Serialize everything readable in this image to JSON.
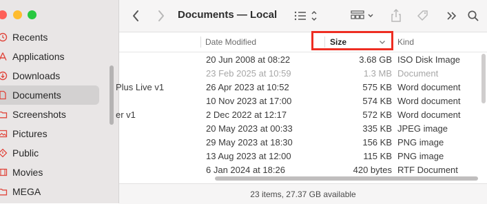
{
  "window": {
    "title": "Documents — Local"
  },
  "sidebar": {
    "items": [
      {
        "label": "Recents",
        "icon": "clock-icon"
      },
      {
        "label": "Applications",
        "icon": "applications-icon"
      },
      {
        "label": "Downloads",
        "icon": "download-icon"
      },
      {
        "label": "Documents",
        "icon": "document-icon",
        "selected": true
      },
      {
        "label": "Screenshots",
        "icon": "folder-icon"
      },
      {
        "label": "Pictures",
        "icon": "pictures-icon"
      },
      {
        "label": "Public",
        "icon": "public-icon"
      },
      {
        "label": "Movies",
        "icon": "movies-icon"
      },
      {
        "label": "MEGA",
        "icon": "folder-icon"
      }
    ]
  },
  "columns": {
    "date_modified": "Date Modified",
    "size": "Size",
    "kind": "Kind"
  },
  "rows": [
    {
      "name": "",
      "date": "20 Jun 2008 at 08:22",
      "size": "3.68 GB",
      "kind": "ISO Disk Image",
      "dim": false
    },
    {
      "name": "",
      "date": "23 Feb 2025 at 10:59",
      "size": "1.3 MB",
      "kind": "Document",
      "dim": true
    },
    {
      "name": "Plus Live v1",
      "date": "26 Apr 2023 at 10:52",
      "size": "575 KB",
      "kind": "Word document",
      "dim": false
    },
    {
      "name": "",
      "date": "10 Nov 2023 at 17:00",
      "size": "574 KB",
      "kind": "Word document",
      "dim": false
    },
    {
      "name": "er v1",
      "date": "2 Dec 2022 at 12:17",
      "size": "572 KB",
      "kind": "Word document",
      "dim": false
    },
    {
      "name": "",
      "date": "20 May 2023 at 00:33",
      "size": "335 KB",
      "kind": "JPEG image",
      "dim": false
    },
    {
      "name": "",
      "date": "29 May 2023 at 18:30",
      "size": "156 KB",
      "kind": "PNG image",
      "dim": false
    },
    {
      "name": "",
      "date": "13 Aug 2023 at 12:00",
      "size": "115 KB",
      "kind": "PNG image",
      "dim": false
    },
    {
      "name": "",
      "date": "6 Jan 2024 at 18:26",
      "size": "420 bytes",
      "kind": "RTF Document",
      "dim": false
    }
  ],
  "status": {
    "text": "23 items, 27.37 GB available"
  },
  "toolbar": {
    "icons": [
      "back-icon",
      "forward-icon",
      "list-view-icon",
      "group-icon",
      "share-icon",
      "tag-icon",
      "more-icon",
      "search-icon"
    ]
  }
}
